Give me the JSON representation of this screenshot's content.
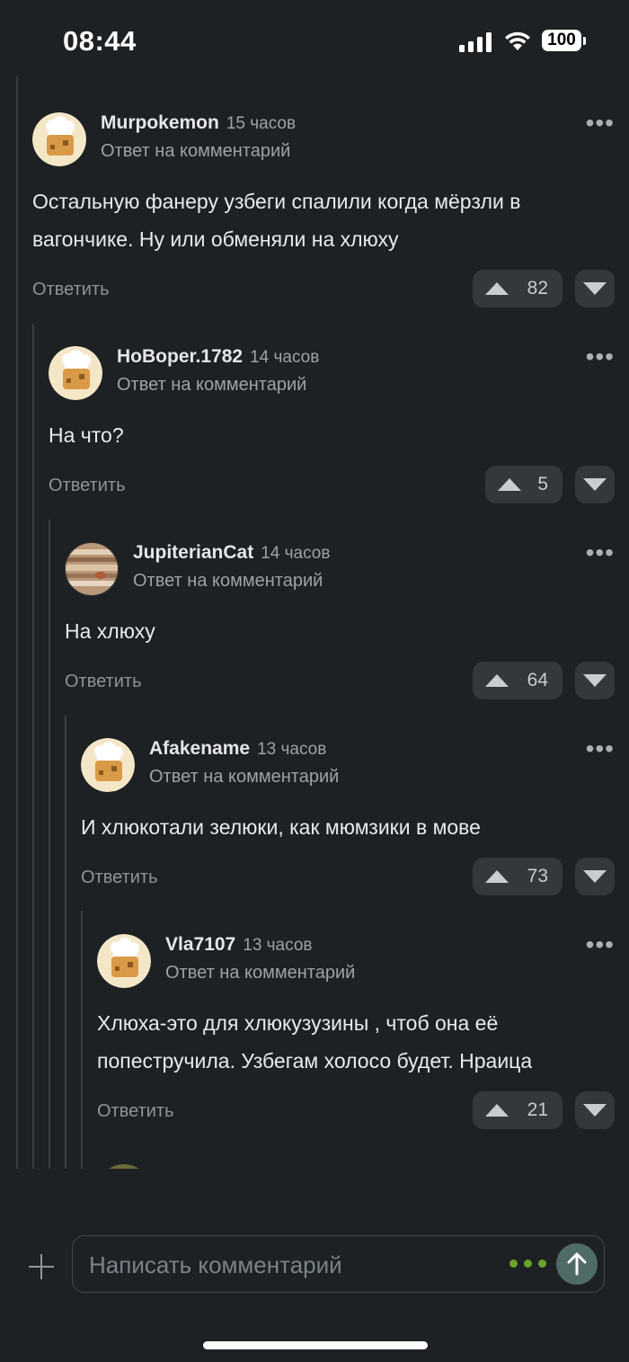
{
  "status_bar": {
    "time": "08:44",
    "battery": "100"
  },
  "composer": {
    "placeholder": "Написать комментарий"
  },
  "comments": [
    {
      "author": "Murpokemon",
      "ago": "15 часов",
      "reply_to": "Ответ на комментарий",
      "text": "Остальную фанеру узбеги спалили когда мёрзли в вагончике. Ну или обменяли на хлюху",
      "reply_label": "Ответить",
      "votes": "82"
    },
    {
      "author": "HoBoper.1782",
      "ago": "14 часов",
      "reply_to": "Ответ на комментарий",
      "text": "На что?",
      "reply_label": "Ответить",
      "votes": "5"
    },
    {
      "author": "JupiterianCat",
      "ago": "14 часов",
      "reply_to": "Ответ на комментарий",
      "text": "На хлюху",
      "reply_label": "Ответить",
      "votes": "64"
    },
    {
      "author": "Afakename",
      "ago": "13 часов",
      "reply_to": "Ответ на комментарий",
      "text": "И хлюкотали зелюки, как мюмзики в мове",
      "reply_label": "Ответить",
      "votes": "73"
    },
    {
      "author": "Vla7107",
      "ago": "13 часов",
      "reply_to": "Ответ на комментарий",
      "text": "Хлюха-это для хлюкузузины , чтоб она её попестручила. Узбегам холосо будет. Нраица",
      "reply_label": "Ответить",
      "votes": "21"
    }
  ]
}
